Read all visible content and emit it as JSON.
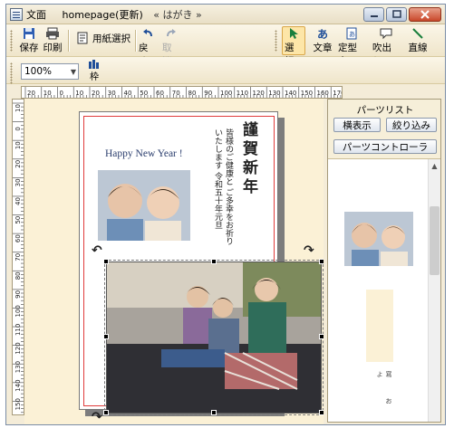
{
  "window": {
    "app_title": "文面",
    "doc_title": "homepage(更新)",
    "sub_title": "« はがき »"
  },
  "toolbar": {
    "save": "保存",
    "print": "印刷",
    "paper_select": "用紙選択",
    "undo": "戻す",
    "redo": "取消",
    "select": "選択",
    "text": "文章",
    "template": "定型文",
    "balloon": "吹出し",
    "line": "直線"
  },
  "toolbar2": {
    "zoom_value": "100%",
    "frame_label": "枠"
  },
  "ruler": {
    "h_labels": [
      "20",
      "10",
      "0",
      "10",
      "20",
      "30",
      "40",
      "50",
      "60",
      "70",
      "80",
      "90",
      "100",
      "110",
      "120",
      "130",
      "140",
      "150",
      "160",
      "170"
    ],
    "v_labels": [
      "10",
      "0",
      "10",
      "20",
      "30",
      "40",
      "50",
      "60",
      "70",
      "80",
      "90",
      "100",
      "110",
      "120",
      "130",
      "140",
      "150"
    ]
  },
  "postcard": {
    "greeting_en": "Happy New Year !",
    "greeting_jp": "謹賀新年",
    "message": "皆様のご健康と ご多幸をお祈りいたします 令和五十年元旦"
  },
  "panel": {
    "title": "パーツリスト",
    "view_button": "横表示",
    "filter_button": "絞り込み",
    "control_button": "パーツコントローラ",
    "thumb_text": "寫 お よ"
  },
  "colors": {
    "accent_red": "#e03b3b",
    "canvas_bg": "#fbf1d6",
    "chrome_bg": "#f4ecd8",
    "selected_tool_bg": "#fde6a8"
  }
}
